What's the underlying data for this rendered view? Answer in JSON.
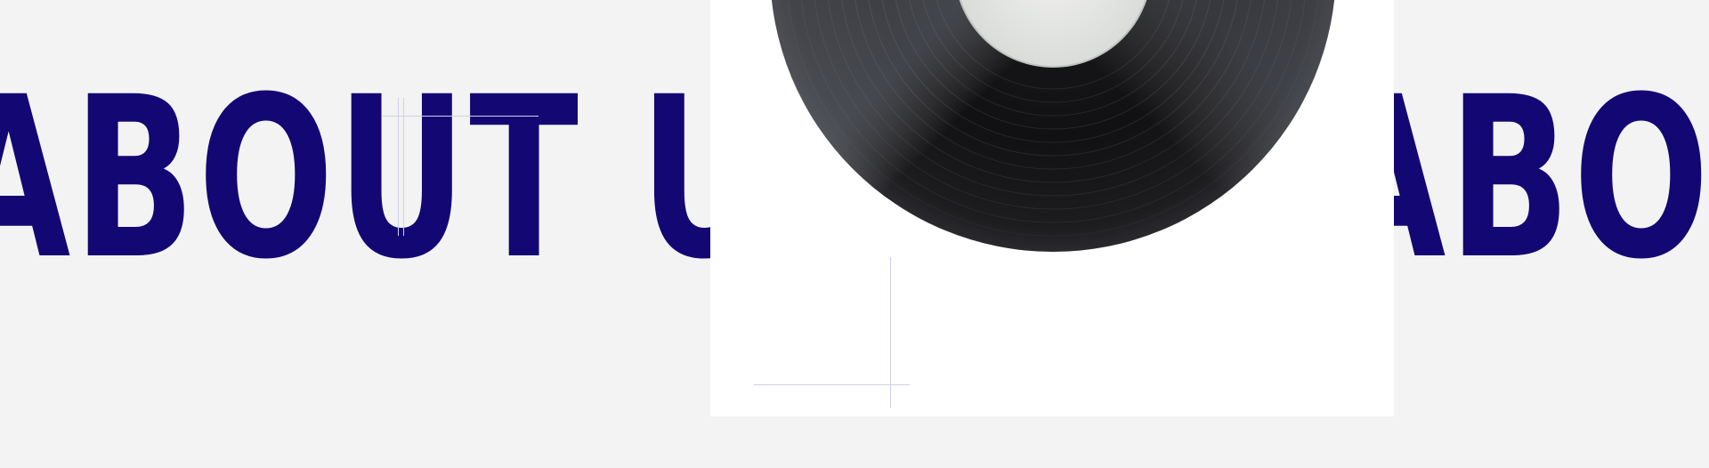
{
  "marquee": {
    "left_text": "ABOUT US",
    "right_text": "ABOUT US"
  },
  "colors": {
    "background": "#f3f3f3",
    "text": "#130873",
    "card": "#ffffff",
    "guide": "#cfd0ea"
  },
  "image": {
    "icon": "vinyl-record"
  }
}
